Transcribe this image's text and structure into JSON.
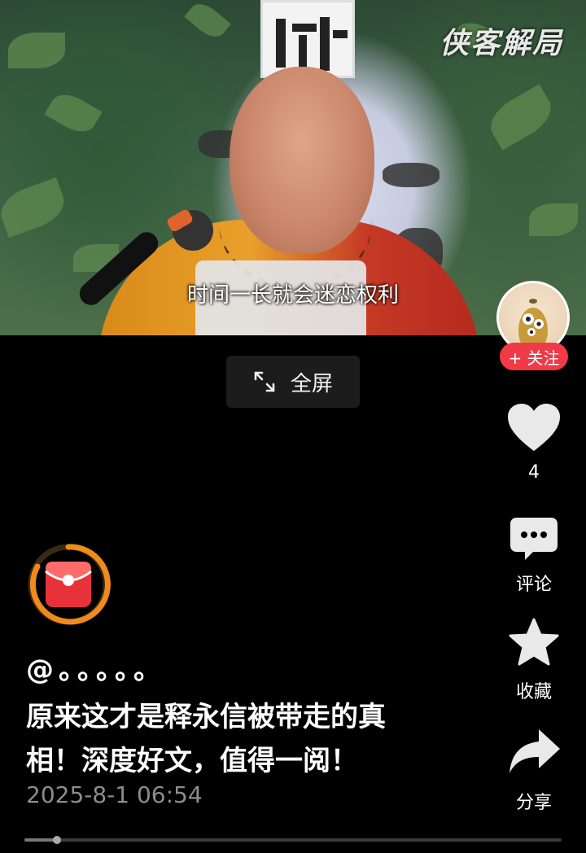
{
  "video": {
    "watermark": "侠客解局",
    "subtitle": "时间一长就会迷恋权利",
    "progress": 0.06
  },
  "fullscreen_button": {
    "label": "全屏",
    "icon": "expand-icon"
  },
  "right_rail": {
    "follow_label": "+ 关注",
    "like": {
      "icon": "heart-icon",
      "count": "4"
    },
    "comment": {
      "icon": "comment-bubble-icon",
      "label": "评论"
    },
    "favorite": {
      "icon": "star-icon",
      "label": "收藏"
    },
    "share": {
      "icon": "share-arrow-icon",
      "label": "分享"
    }
  },
  "post": {
    "author_handle": "@。。。。。",
    "caption_line1": "原来这才是释永信被带走的真",
    "caption_line2": "相！深度好文，值得一阅！",
    "timestamp": "2025-8-1 06:54"
  },
  "colors": {
    "follow_red": "#f03a48",
    "red_packet_ring": "#f08a1c",
    "red_packet": "#e8323a"
  }
}
